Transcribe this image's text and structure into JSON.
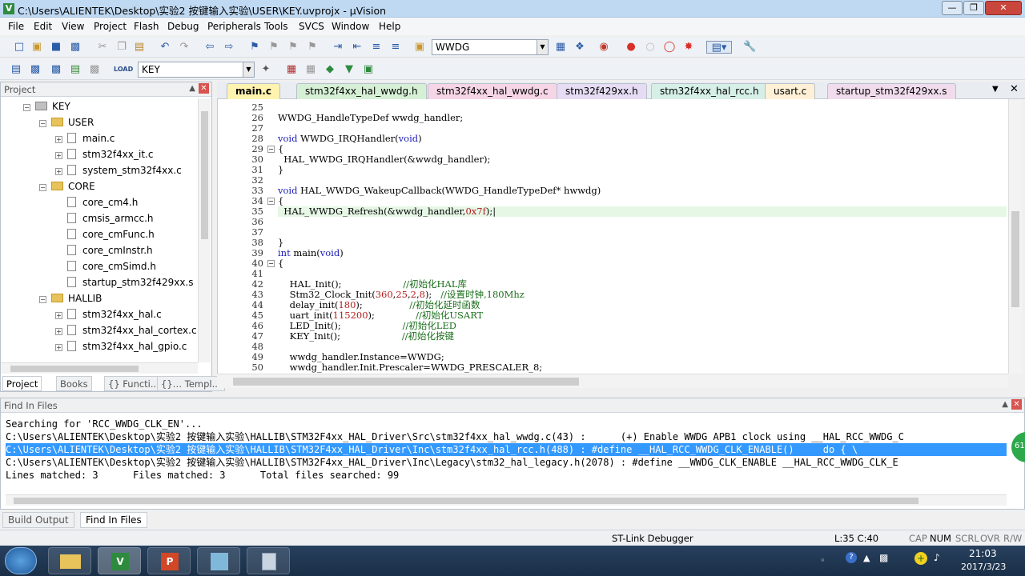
{
  "window": {
    "title": "C:\\Users\\ALIENTEK\\Desktop\\实验2 按键输入实验\\USER\\KEY.uvprojx - µVision"
  },
  "menu": [
    "File",
    "Edit",
    "View",
    "Project",
    "Flash",
    "Debug",
    "Peripherals",
    "Tools",
    "SVCS",
    "Window",
    "Help"
  ],
  "toolbar": {
    "find_value": "WWDG",
    "target_value": "KEY"
  },
  "project_panel": {
    "header": "Project",
    "items": [
      {
        "label": "KEY",
        "type": "root"
      },
      {
        "label": "USER",
        "type": "folder"
      },
      {
        "label": "main.c",
        "type": "file"
      },
      {
        "label": "stm32f4xx_it.c",
        "type": "file"
      },
      {
        "label": "system_stm32f4xx.c",
        "type": "file"
      },
      {
        "label": "CORE",
        "type": "folder"
      },
      {
        "label": "core_cm4.h",
        "type": "file"
      },
      {
        "label": "cmsis_armcc.h",
        "type": "file"
      },
      {
        "label": "core_cmFunc.h",
        "type": "file"
      },
      {
        "label": "core_cmInstr.h",
        "type": "file"
      },
      {
        "label": "core_cmSimd.h",
        "type": "file"
      },
      {
        "label": "startup_stm32f429xx.s",
        "type": "file"
      },
      {
        "label": "HALLIB",
        "type": "folder"
      },
      {
        "label": "stm32f4xx_hal.c",
        "type": "file"
      },
      {
        "label": "stm32f4xx_hal_cortex.c",
        "type": "file"
      },
      {
        "label": "stm32f4xx_hal_gpio.c",
        "type": "file"
      }
    ],
    "tabs": [
      "Project",
      "Books",
      "{} Functi...",
      "{}… Templ..."
    ]
  },
  "editor_tabs": [
    {
      "label": "main.c",
      "color": "#fff3b0",
      "active": true
    },
    {
      "label": "stm32f4xx_hal_wwdg.h",
      "color": "#d6f0d6"
    },
    {
      "label": "stm32f4xx_hal_wwdg.c",
      "color": "#f6d6e6"
    },
    {
      "label": "stm32f429xx.h",
      "color": "#e6dcf4"
    },
    {
      "label": "stm32f4xx_hal_rcc.h",
      "color": "#d6f0e8"
    },
    {
      "label": "usart.c",
      "color": "#fff0d6"
    },
    {
      "label": "startup_stm32f429xx.s",
      "color": "#f0dcec"
    }
  ],
  "code_lines": [
    {
      "n": "25",
      "t": ""
    },
    {
      "n": "26",
      "t": "WWDG_HandleTypeDef wwdg_handler;"
    },
    {
      "n": "27",
      "t": ""
    },
    {
      "n": "28",
      "t": "void WWDG_IRQHandler(void)"
    },
    {
      "n": "29",
      "t": "{"
    },
    {
      "n": "30",
      "t": "  HAL_WWDG_IRQHandler(&wwdg_handler);"
    },
    {
      "n": "31",
      "t": "}"
    },
    {
      "n": "32",
      "t": ""
    },
    {
      "n": "33",
      "t": "void HAL_WWDG_WakeupCallback(WWDG_HandleTypeDef* hwwdg)"
    },
    {
      "n": "34",
      "t": "{"
    },
    {
      "n": "35",
      "t": "  HAL_WWDG_Refresh(&wwdg_handler,0x7f);|"
    },
    {
      "n": "36",
      "t": ""
    },
    {
      "n": "37",
      "t": ""
    },
    {
      "n": "38",
      "t": "}"
    },
    {
      "n": "39",
      "t": "int main(void)"
    },
    {
      "n": "40",
      "t": "{"
    },
    {
      "n": "41",
      "t": ""
    },
    {
      "n": "42",
      "t": "    HAL_Init();                     //初始化HAL库"
    },
    {
      "n": "43",
      "t": "    Stm32_Clock_Init(360,25,2,8);   //设置时钟,180Mhz"
    },
    {
      "n": "44",
      "t": "    delay_init(180);                //初始化延时函数"
    },
    {
      "n": "45",
      "t": "    uart_init(115200);              //初始化USART"
    },
    {
      "n": "46",
      "t": "    LED_Init();                     //初始化LED"
    },
    {
      "n": "47",
      "t": "    KEY_Init();                     //初始化按键"
    },
    {
      "n": "48",
      "t": ""
    },
    {
      "n": "49",
      "t": "    wwdg_handler.Instance=WWDG;"
    },
    {
      "n": "50",
      "t": "    wwdg_handler.Init.Prescaler=WWDG_PRESCALER_8;"
    }
  ],
  "find_panel": {
    "header": "Find In Files",
    "lines": [
      "Searching for 'RCC_WWDG_CLK_EN'...",
      "C:\\Users\\ALIENTEK\\Desktop\\实验2 按键输入实验\\HALLIB\\STM32F4xx_HAL_Driver\\Src\\stm32f4xx_hal_wwdg.c(43) :      (+) Enable WWDG APB1 clock using __HAL_RCC_WWDG_C",
      "C:\\Users\\ALIENTEK\\Desktop\\实验2 按键输入实验\\HALLIB\\STM32F4xx_HAL_Driver\\Inc\\stm32f4xx_hal_rcc.h(488) : #define __HAL_RCC_WWDG_CLK_ENABLE()     do { \\",
      "C:\\Users\\ALIENTEK\\Desktop\\实验2 按键输入实验\\HALLIB\\STM32F4xx_HAL_Driver\\Inc\\Legacy\\stm32_hal_legacy.h(2078) : #define __WWDG_CLK_ENABLE __HAL_RCC_WWDG_CLK_E",
      "Lines matched: 3      Files matched: 3      Total files searched: 99"
    ],
    "badge": "61"
  },
  "bottom_tabs": [
    "Build Output",
    "Find In Files"
  ],
  "status": {
    "debugger": "ST-Link Debugger",
    "position": "L:35 C:40",
    "caps": "CAP",
    "num": "NUM",
    "scrl": "SCRL",
    "ovr": "OVR",
    "rw": "R/W"
  },
  "taskbar": {
    "time": "21:03",
    "date": "2017/3/23"
  }
}
